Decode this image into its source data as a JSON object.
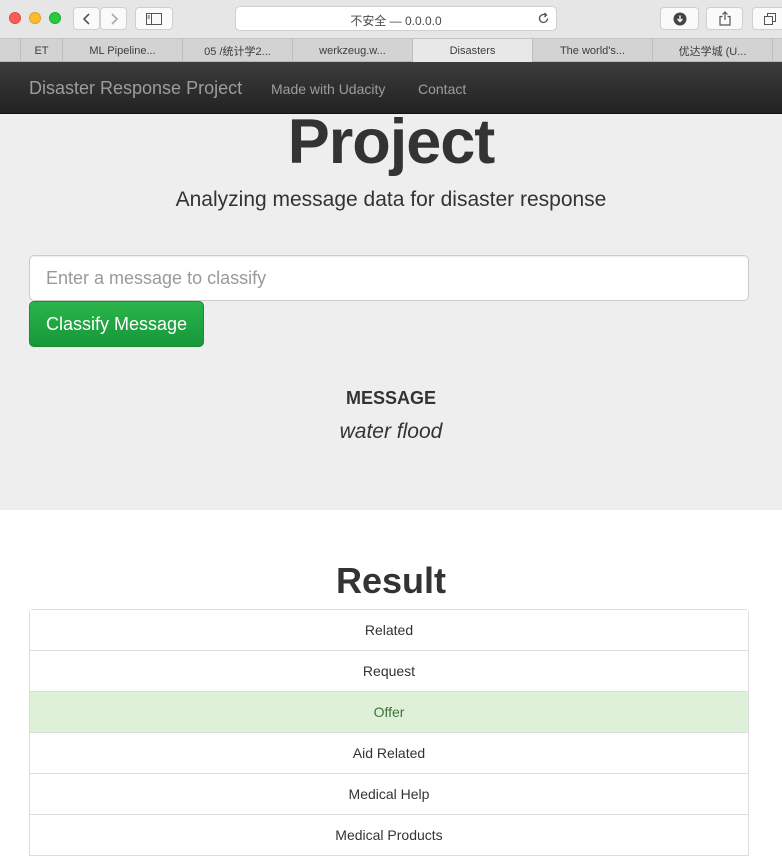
{
  "browser": {
    "url_text": "不安全 — 0.0.0.0",
    "tabs": [
      {
        "label": "ET",
        "active": false
      },
      {
        "label": "ML Pipeline...",
        "active": false
      },
      {
        "label": "05 /统计学2...",
        "active": false
      },
      {
        "label": "werkzeug.w...",
        "active": false
      },
      {
        "label": "Disasters",
        "active": true
      },
      {
        "label": "The world's...",
        "active": false
      },
      {
        "label": "优达学城 (U...",
        "active": false
      }
    ]
  },
  "navbar": {
    "brand": "Disaster Response Project",
    "links": [
      "Made with Udacity",
      "Contact"
    ]
  },
  "jumbotron": {
    "title": "Project",
    "subtitle": "Analyzing message data for disaster response",
    "input_placeholder": "Enter a message to classify",
    "input_value": "",
    "button_label": "Classify Message",
    "message_heading": "MESSAGE",
    "message_text": "water flood"
  },
  "results": {
    "title": "Result",
    "items": [
      {
        "label": "Related",
        "positive": false
      },
      {
        "label": "Request",
        "positive": false
      },
      {
        "label": "Offer",
        "positive": true
      },
      {
        "label": "Aid Related",
        "positive": false
      },
      {
        "label": "Medical Help",
        "positive": false
      },
      {
        "label": "Medical Products",
        "positive": false
      }
    ]
  },
  "colors": {
    "positive_row_bg": "#dff0d8",
    "positive_row_text": "#3c763d",
    "classify_button": "#1fa043",
    "navbar": "#2b2b2b"
  }
}
